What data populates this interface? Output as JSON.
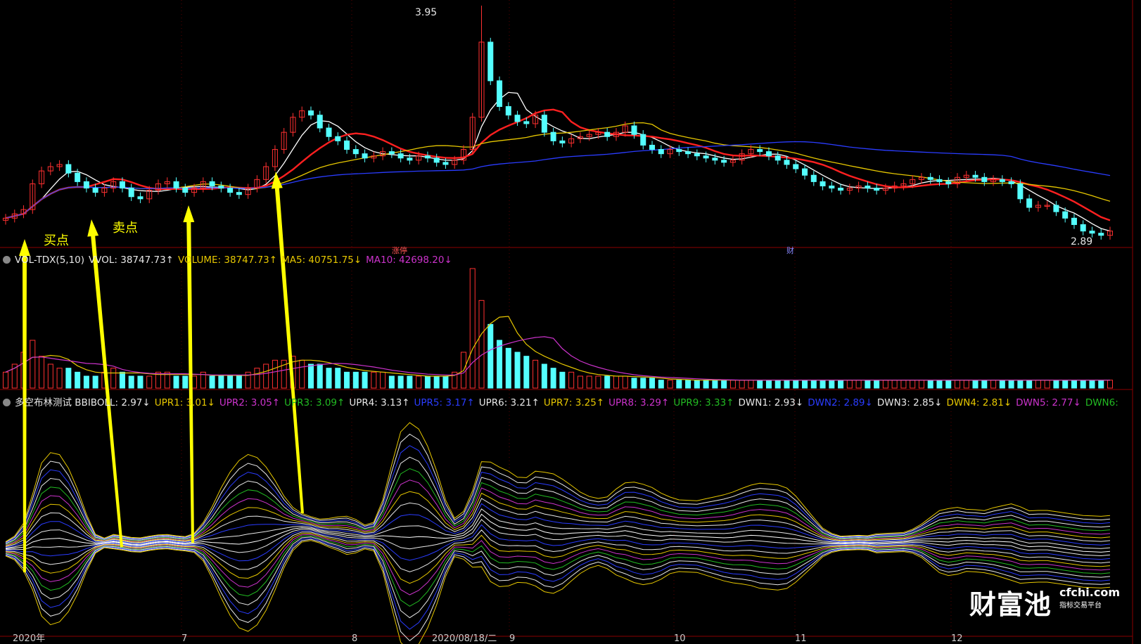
{
  "panel_main": {
    "price_high_label": "3.95",
    "price_low_label": "2.89",
    "event_tags": [
      "涨停",
      "财"
    ],
    "annotations": [
      "买点",
      "卖点"
    ]
  },
  "panel_volume": {
    "legend": [
      {
        "text": "VOL-TDX(5,10)",
        "color": "#e8e8e8"
      },
      {
        "text": "VVOL: 38747.73↑",
        "color": "#e8e8e8"
      },
      {
        "text": "VOLUME: 38747.73↑",
        "color": "#e6c700"
      },
      {
        "text": "MA5: 40751.75↓",
        "color": "#e6c700"
      },
      {
        "text": "MA10: 42698.20↓",
        "color": "#cc33cc"
      }
    ]
  },
  "panel_boll": {
    "legend": [
      {
        "text": "多空布林测试 BBIBOLL: 2.97↓",
        "color": "#e8e8e8"
      },
      {
        "text": "UPR1: 3.01↓",
        "color": "#e6c700"
      },
      {
        "text": "UPR2: 3.05↑",
        "color": "#cc33cc"
      },
      {
        "text": "UPR3: 3.09↑",
        "color": "#22bb22"
      },
      {
        "text": "UPR4: 3.13↑",
        "color": "#e8e8e8"
      },
      {
        "text": "UPR5: 3.17↑",
        "color": "#2a3cff"
      },
      {
        "text": "UPR6: 3.21↑",
        "color": "#e8e8e8"
      },
      {
        "text": "UPR7: 3.25↑",
        "color": "#e6c700"
      },
      {
        "text": "UPR8: 3.29↑",
        "color": "#cc33cc"
      },
      {
        "text": "UPR9: 3.33↑",
        "color": "#22bb22"
      },
      {
        "text": "DWN1: 2.93↓",
        "color": "#e8e8e8"
      },
      {
        "text": "DWN2: 2.89↓",
        "color": "#2a3cff"
      },
      {
        "text": "DWN3: 2.85↓",
        "color": "#e8e8e8"
      },
      {
        "text": "DWN4: 2.81↓",
        "color": "#e6c700"
      },
      {
        "text": "DWN5: 2.77↓",
        "color": "#cc33cc"
      },
      {
        "text": "DWN6:",
        "color": "#22bb22"
      }
    ]
  },
  "x_axis": [
    "2020年",
    "7",
    "8",
    "2020/08/18/二",
    "9",
    "10",
    "11",
    "12"
  ],
  "watermark": {
    "big": "财富池",
    "url": "cfchi.com",
    "sub": "指标交易平台"
  },
  "chart_data": {
    "type": "candlestick",
    "title": "",
    "price_range": [
      2.85,
      3.97
    ],
    "close": [
      2.98,
      3.0,
      3.02,
      3.14,
      3.2,
      3.22,
      3.23,
      3.19,
      3.15,
      3.12,
      3.1,
      3.12,
      3.15,
      3.12,
      3.08,
      3.07,
      3.11,
      3.14,
      3.15,
      3.12,
      3.1,
      3.12,
      3.15,
      3.13,
      3.12,
      3.1,
      3.09,
      3.12,
      3.16,
      3.22,
      3.3,
      3.38,
      3.45,
      3.48,
      3.46,
      3.4,
      3.36,
      3.34,
      3.3,
      3.28,
      3.26,
      3.27,
      3.29,
      3.28,
      3.26,
      3.25,
      3.27,
      3.26,
      3.24,
      3.23,
      3.25,
      3.3,
      3.45,
      3.8,
      3.62,
      3.5,
      3.46,
      3.43,
      3.42,
      3.46,
      3.38,
      3.34,
      3.33,
      3.35,
      3.36,
      3.37,
      3.38,
      3.36,
      3.38,
      3.41,
      3.37,
      3.32,
      3.3,
      3.28,
      3.3,
      3.29,
      3.28,
      3.27,
      3.26,
      3.25,
      3.24,
      3.25,
      3.28,
      3.3,
      3.29,
      3.27,
      3.25,
      3.23,
      3.21,
      3.18,
      3.15,
      3.13,
      3.12,
      3.11,
      3.12,
      3.13,
      3.12,
      3.11,
      3.12,
      3.13,
      3.14,
      3.16,
      3.17,
      3.16,
      3.15,
      3.14,
      3.17,
      3.18,
      3.17,
      3.15,
      3.16,
      3.15,
      3.14,
      3.07,
      3.03,
      3.04,
      3.04,
      3.01,
      2.98,
      2.95,
      2.92,
      2.91,
      2.9,
      2.92
    ],
    "series": [
      {
        "name": "",
        "kind": "ma",
        "color": "#ffffff"
      },
      {
        "name": "",
        "kind": "ma",
        "color": "#ff2020"
      },
      {
        "name": "",
        "kind": "ma",
        "color": "#e6c700"
      },
      {
        "name": "",
        "kind": "ma",
        "color": "#2a3cff"
      }
    ],
    "volume": [
      4,
      6,
      9,
      12,
      8,
      6,
      5,
      5,
      4,
      3,
      3,
      4,
      5,
      4,
      3,
      3,
      3,
      4,
      4,
      3,
      3,
      3,
      4,
      3,
      3,
      3,
      3,
      4,
      5,
      6,
      7,
      7,
      8,
      7,
      6,
      6,
      5,
      5,
      4,
      4,
      4,
      4,
      4,
      3,
      3,
      3,
      3,
      3,
      3,
      3,
      4,
      9,
      30,
      22,
      16,
      12,
      10,
      9,
      8,
      7,
      6,
      5,
      4,
      4,
      3,
      3,
      3,
      3,
      3,
      3,
      2.5,
      2.5,
      2.5,
      2,
      2,
      2,
      2,
      2,
      2,
      2,
      2,
      2,
      2,
      2,
      2,
      2,
      2,
      2,
      2,
      2,
      2,
      2,
      2,
      2,
      2,
      2,
      2,
      2,
      2,
      2,
      2,
      2,
      2,
      2,
      2,
      2,
      2,
      2,
      2,
      2,
      2,
      2,
      2,
      2,
      2,
      2,
      2,
      2,
      2,
      2,
      2,
      2,
      2,
      2
    ],
    "boll_width": [
      0.3,
      0.5,
      1.0,
      2.0,
      3.2,
      3.6,
      3.5,
      3.0,
      2.2,
      1.2,
      0.4,
      0.2,
      0.3,
      0.3,
      0.3,
      0.3,
      0.3,
      0.3,
      0.3,
      0.3,
      0.3,
      0.4,
      0.8,
      1.5,
      2.3,
      3.0,
      3.5,
      3.7,
      3.5,
      3.0,
      2.3,
      1.5,
      0.9,
      0.6,
      0.5,
      0.5,
      0.6,
      0.7,
      0.8,
      0.7,
      0.5,
      0.6,
      1.5,
      3.0,
      4.4,
      4.8,
      4.5,
      3.8,
      2.8,
      1.6,
      0.8,
      1.0,
      1.6,
      2.2,
      2.5,
      2.5,
      2.4,
      2.2,
      2.2,
      2.4,
      2.5,
      2.5,
      2.3,
      2.0,
      1.7,
      1.5,
      1.4,
      1.5,
      1.8,
      2.0,
      2.1,
      2.1,
      2.0,
      1.8,
      1.6,
      1.5,
      1.5,
      1.5,
      1.6,
      1.7,
      1.8,
      1.9,
      2.0,
      2.1,
      2.2,
      2.2,
      2.2,
      2.1,
      1.8,
      1.4,
      1.0,
      0.6,
      0.4,
      0.3,
      0.3,
      0.3,
      0.3,
      0.4,
      0.4,
      0.4,
      0.4,
      0.5,
      0.7,
      1.0,
      1.3,
      1.4,
      1.4,
      1.3,
      1.3,
      1.3,
      1.4,
      1.5,
      1.6,
      1.6,
      1.5,
      1.5,
      1.5,
      1.5,
      1.5,
      1.5,
      1.5,
      1.5,
      1.5,
      1.5
    ]
  }
}
